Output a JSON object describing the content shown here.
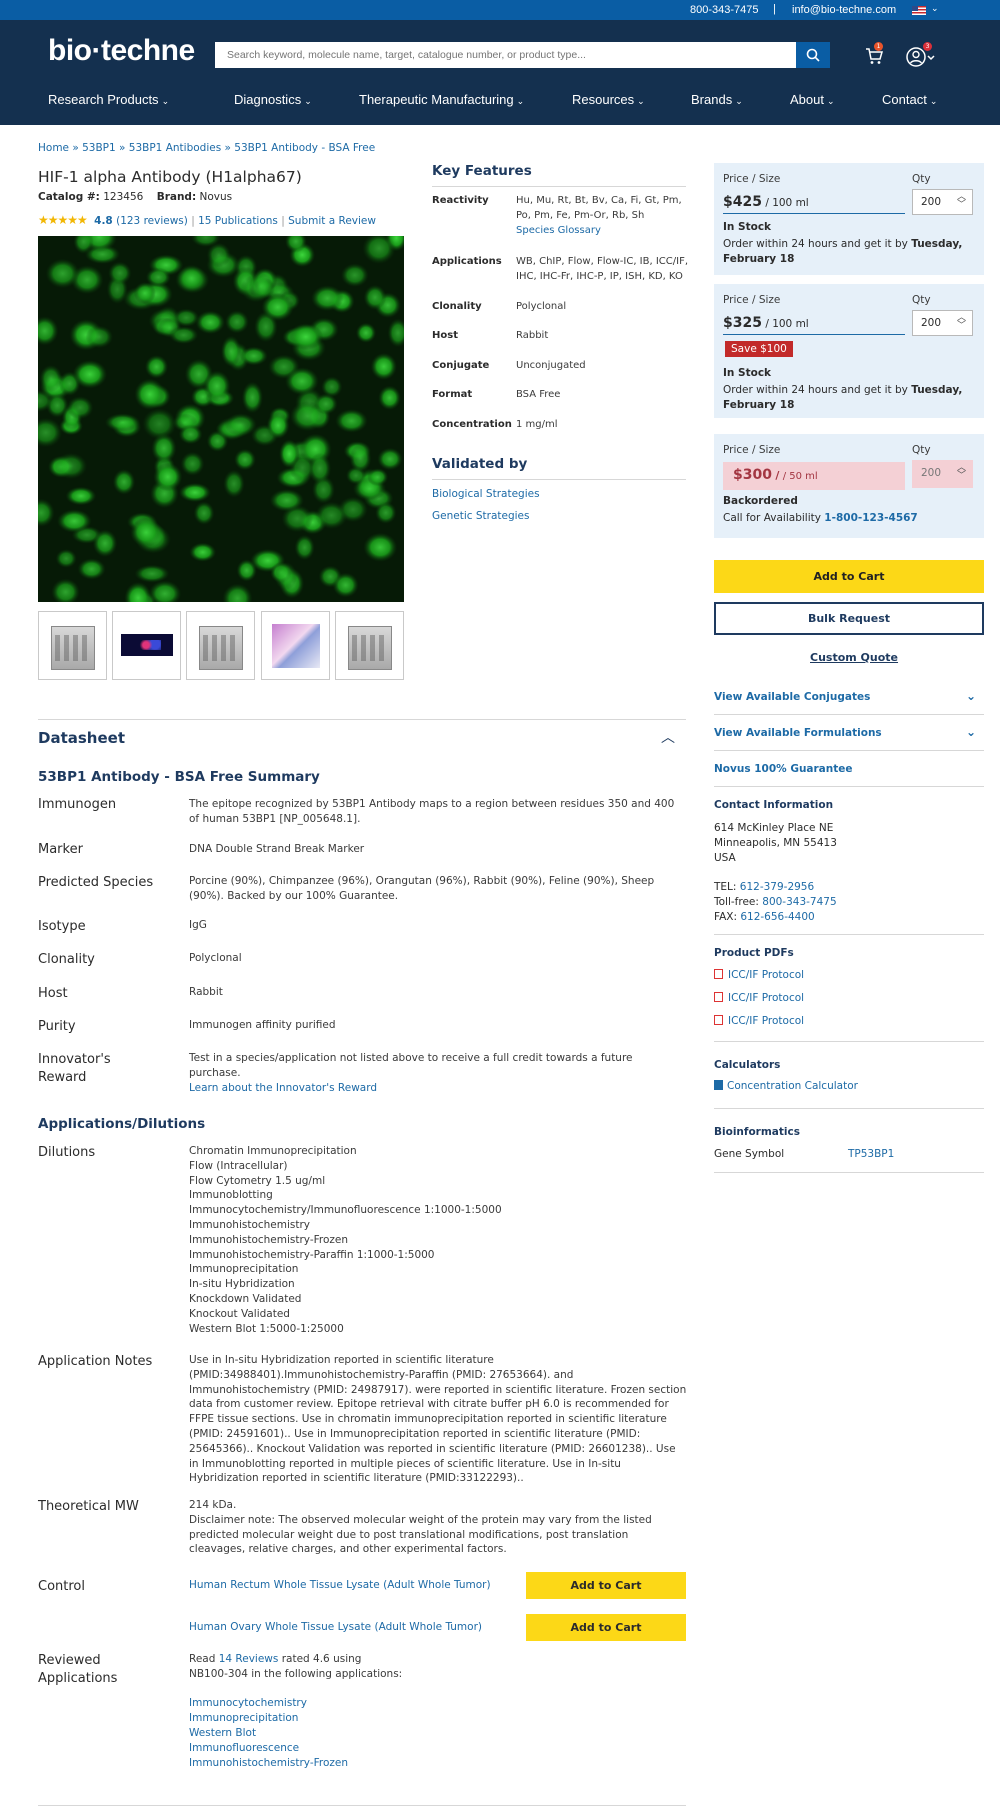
{
  "utility": {
    "phone": "800-343-7475",
    "separator": "|",
    "email": "info@bio-techne.com"
  },
  "header": {
    "logo": "bio·techne",
    "search_placeholder": "Search keyword, molecule name, target, catalogue number, or product type...",
    "cart_count": "1",
    "user_count": "3"
  },
  "nav": [
    "Research Products",
    "Diagnostics",
    "Therapeutic Manufacturing",
    "Resources",
    "Brands",
    "About",
    "Contact"
  ],
  "breadcrumb": "Home » 53BP1 » 53BP1 Antibodies » 53BP1 Antibody - BSA Free",
  "product": {
    "title": "HIF-1 alpha Antibody (H1alpha67)",
    "catalog_label": "Catalog #:",
    "catalog_value": "123456",
    "brand_label": "Brand:",
    "brand_value": "Novus",
    "stars": "★★★★★",
    "score": "4.8",
    "reviews": "(123 reviews)",
    "publications": "15 Publications",
    "submit_review": "Submit a Review"
  },
  "key_features": {
    "title": "Key Features",
    "rows": [
      {
        "k": "Reactivity",
        "v": "Hu, Mu, Rt, Bt, Bv, Ca, Fi, Gt, Pm, Po, Pm, Fe, Pm-Or, Rb, Sh",
        "link": "Species Glossary"
      },
      {
        "k": "Applications",
        "v": "WB, ChIP, Flow, Flow-IC, IB, ICC/IF, IHC, IHC-Fr, IHC-P, IP, ISH, KD, KO"
      },
      {
        "k": "Clonality",
        "v": "Polyclonal"
      },
      {
        "k": "Host",
        "v": "Rabbit"
      },
      {
        "k": "Conjugate",
        "v": "Unconjugated"
      },
      {
        "k": "Format",
        "v": "BSA Free"
      },
      {
        "k": "Concentration",
        "v": "1 mg/ml"
      }
    ],
    "validated_title": "Validated by",
    "validated_links": [
      "Biological Strategies",
      "Genetic Strategies"
    ]
  },
  "pricing": [
    {
      "label": "Price / Size",
      "qty_label": "Qty",
      "price": "$425",
      "size": "/ 100 ml",
      "qty": "200",
      "stock": "In Stock",
      "note_a": "Order within 24 hours and get it by ",
      "note_b": "Tuesday, February 18"
    },
    {
      "label": "Price / Size",
      "qty_label": "Qty",
      "price": "$325",
      "size": "/ 100 ml",
      "qty": "200",
      "save": "Save $100",
      "stock": "In Stock",
      "note_a": "Order within 24 hours and get it by ",
      "note_b": "Tuesday, February 18"
    },
    {
      "label": "Price / Size",
      "qty_label": "Qty",
      "price": "$300",
      "size": "/ 50 ml",
      "qty": "200",
      "stock": "Backordered",
      "note_a": "Call for Availability ",
      "note_b": "1-800-123-4567"
    }
  ],
  "actions": {
    "add_to_cart": "Add to Cart",
    "bulk": "Bulk Request",
    "custom_quote": "Custom Quote"
  },
  "sidebar": {
    "conjugates": "View Available Conjugates",
    "formulations": "View Available Formulations",
    "guarantee": "Novus 100% Guarantee",
    "contact_title": "Contact Information",
    "address": [
      "614 McKinley Place NE",
      "Minneapolis, MN 55413",
      "USA"
    ],
    "tel_label": "TEL:",
    "tel": "612-379-2956",
    "tollfree_label": "Toll-free:",
    "tollfree": "800-343-7475",
    "fax_label": "FAX:",
    "fax": "612-656-4400",
    "pdfs_title": "Product PDFs",
    "pdfs": [
      "ICC/IF Protocol",
      "ICC/IF Protocol",
      "ICC/IF Protocol"
    ],
    "calc_title": "Calculators",
    "calc_link": "Concentration Calculator",
    "bio_title": "Bioinformatics",
    "gene_label": "Gene Symbol",
    "gene_value": "TP53BP1"
  },
  "datasheet": {
    "title": "Datasheet",
    "summary_title": "53BP1 Antibody - BSA Free Summary",
    "rows": {
      "immunogen": {
        "label": "Immunogen",
        "value": "The epitope recognized by 53BP1 Antibody maps to a region between residues 350 and 400 of human 53BP1 [NP_005648.1]."
      },
      "marker": {
        "label": "Marker",
        "value": "DNA Double Strand Break Marker"
      },
      "species": {
        "label": "Predicted Species",
        "value": "Porcine (90%), Chimpanzee (96%), Orangutan (96%), Rabbit (90%), Feline (90%), Sheep (90%). Backed by our 100% Guarantee."
      },
      "isotype": {
        "label": "Isotype",
        "value": "IgG"
      },
      "clonality": {
        "label": "Clonality",
        "value": "Polyclonal"
      },
      "host": {
        "label": "Host",
        "value": "Rabbit"
      },
      "purity": {
        "label": "Purity",
        "value": "Immunogen affinity purified"
      },
      "reward": {
        "label": "Innovator's Reward",
        "value": "Test in a species/application not listed above to receive a full credit towards a future purchase.",
        "link": "Learn about the Innovator's Reward"
      }
    },
    "apps_title": "Applications/Dilutions",
    "dilutions_label": "Dilutions",
    "dilutions": [
      "Chromatin Immunoprecipitation",
      "Flow (Intracellular)",
      "Flow Cytometry 1.5 ug/ml",
      "Immunoblotting",
      "Immunocytochemistry/Immunofluorescence 1:1000-1:5000",
      "Immunohistochemistry",
      "Immunohistochemistry-Frozen",
      "Immunohistochemistry-Paraffin 1:1000-1:5000",
      "Immunoprecipitation",
      "In-situ Hybridization",
      "Knockdown Validated",
      "Knockout Validated",
      "Western Blot 1:5000-1:25000"
    ],
    "app_notes_label": "Application Notes",
    "app_notes": "Use in In-situ Hybridization reported in scientific literature (PMID:34988401).Immunohistochemistry-Paraffin (PMID: 27653664). and Immunohistochemistry (PMID: 24987917). were reported in scientific literature. Frozen section data from customer review. Epitope retrieval with citrate buffer pH 6.0 is recommended for FFPE tissue sections. Use in chromatin immunoprecipitation reported in scientific literature (PMID: 24591601).. Use in Immunoprecipitation reported in scientific literature (PMID: 25645366).. Knockout Validation was reported in scientific literature (PMID: 26601238).. Use in Immunoblotting reported in multiple pieces of scientific literature. Use in In-situ Hybridization reported in scientific literature (PMID:33122293)..",
    "mw_label": "Theoretical MW",
    "mw_value": "214 kDa.",
    "mw_note": "Disclaimer note: The observed molecular weight of the protein may vary from the listed predicted molecular weight due to post translational modifications, post translation cleavages, relative charges, and other experimental factors.",
    "control_label": "Control",
    "controls": [
      "Human Rectum Whole Tissue Lysate (Adult Whole Tumor)",
      "Human Ovary Whole Tissue Lysate (Adult Whole Tumor)"
    ],
    "reviewed_label": "Reviewed Applications",
    "reviewed_a": "Read ",
    "reviewed_link": "14 Reviews",
    "reviewed_b": " rated 4.6 using",
    "reviewed_c": "NB100-304 in the following applications:",
    "reviewed_apps": [
      "Immunocytochemistry",
      "Immunoprecipitation",
      "Western Blot",
      "Immunofluorescence",
      "Immunohistochemistry-Frozen"
    ]
  }
}
